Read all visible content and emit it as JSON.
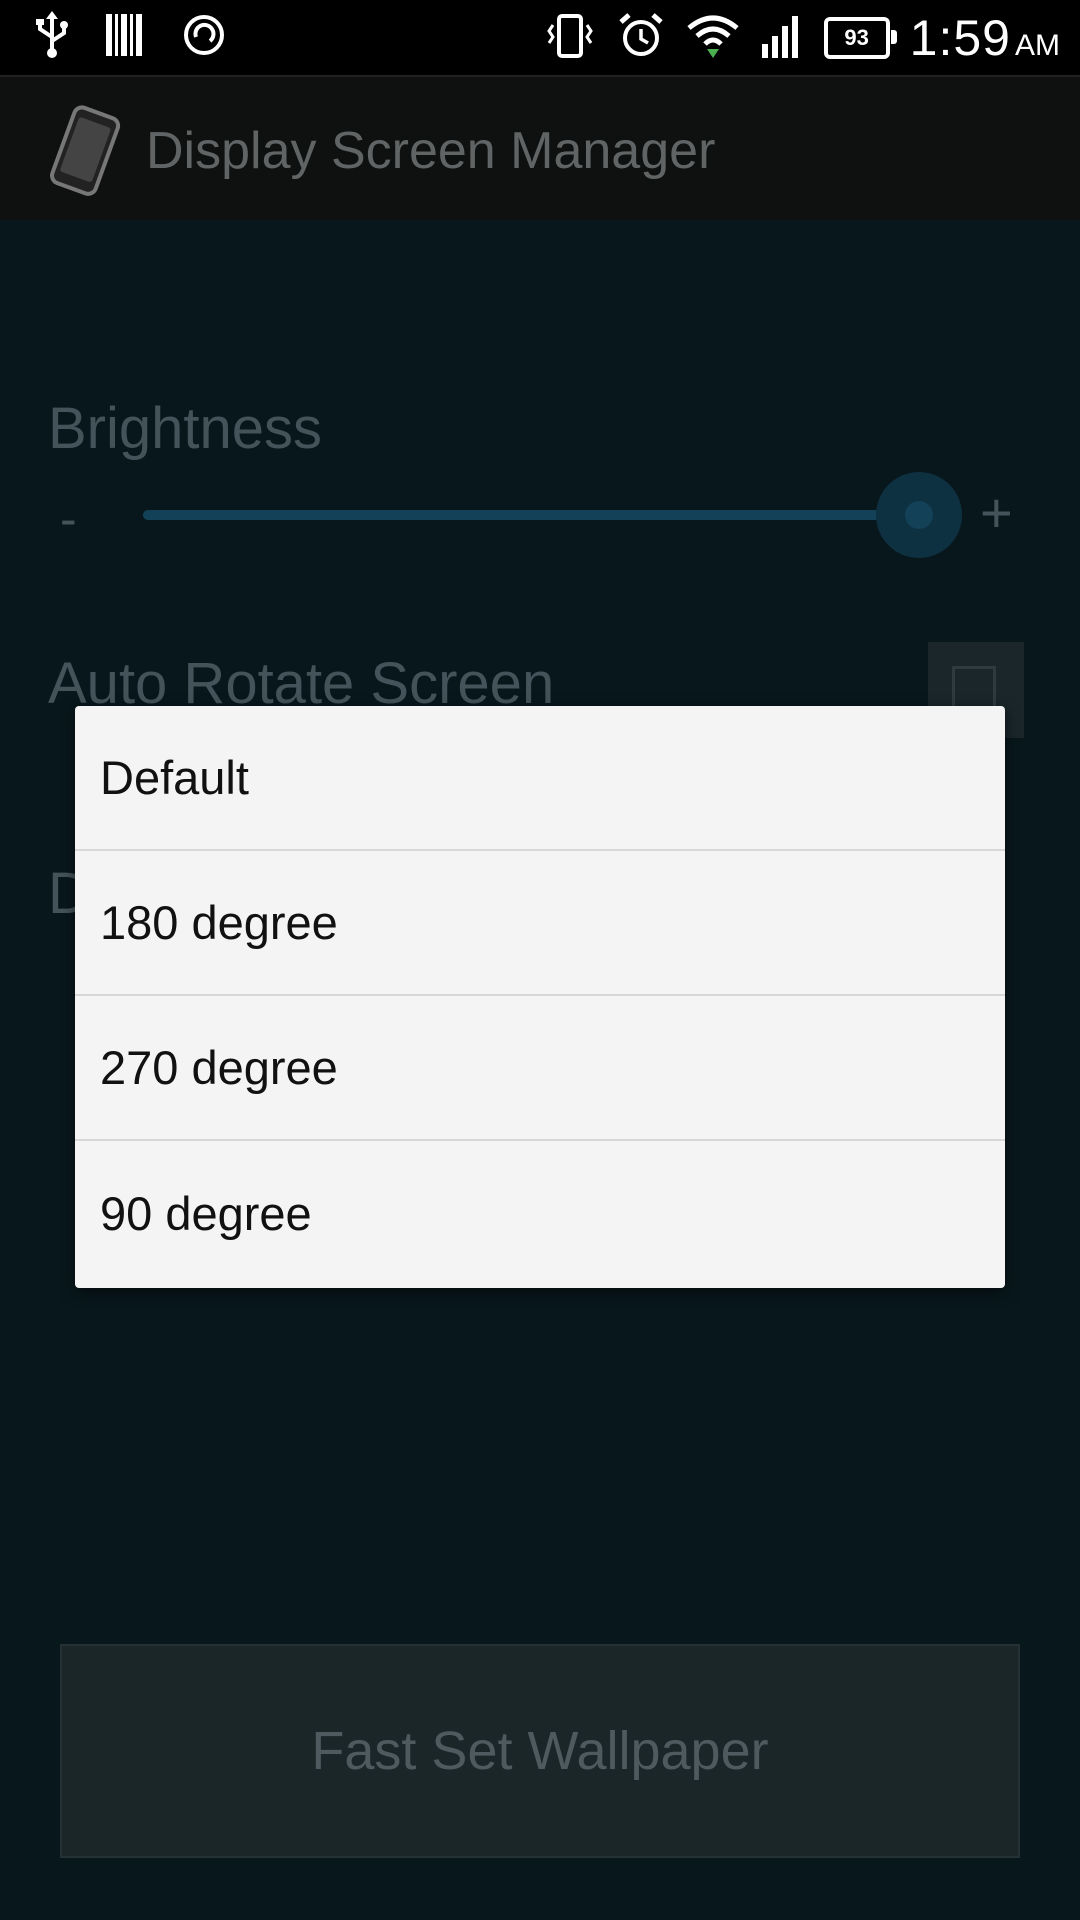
{
  "status_bar": {
    "time": "1:59",
    "ampm": "AM",
    "battery_level": "93",
    "icons_left": [
      "usb-icon",
      "barcode-icon",
      "sync-icon"
    ],
    "icons_right": [
      "vibrate-icon",
      "alarm-icon",
      "wifi-icon",
      "signal-icon",
      "battery-icon"
    ]
  },
  "action_bar": {
    "title": "Display Screen Manager",
    "icon": "phone-app-icon"
  },
  "main": {
    "brightness_label": "Brightness",
    "minus": "-",
    "plus": "+",
    "brightness_level": 0.98,
    "auto_rotate_label": "Auto Rotate Screen",
    "auto_rotate_checked": false,
    "partial_label": "D",
    "wallpaper_button": "Fast Set Wallpaper"
  },
  "dialog": {
    "options": [
      "Default",
      "180 degree",
      "270 degree",
      "90 degree"
    ]
  },
  "colors": {
    "accent": "#134158",
    "background": "#08171c",
    "dialog_bg": "#f4f4f4"
  }
}
